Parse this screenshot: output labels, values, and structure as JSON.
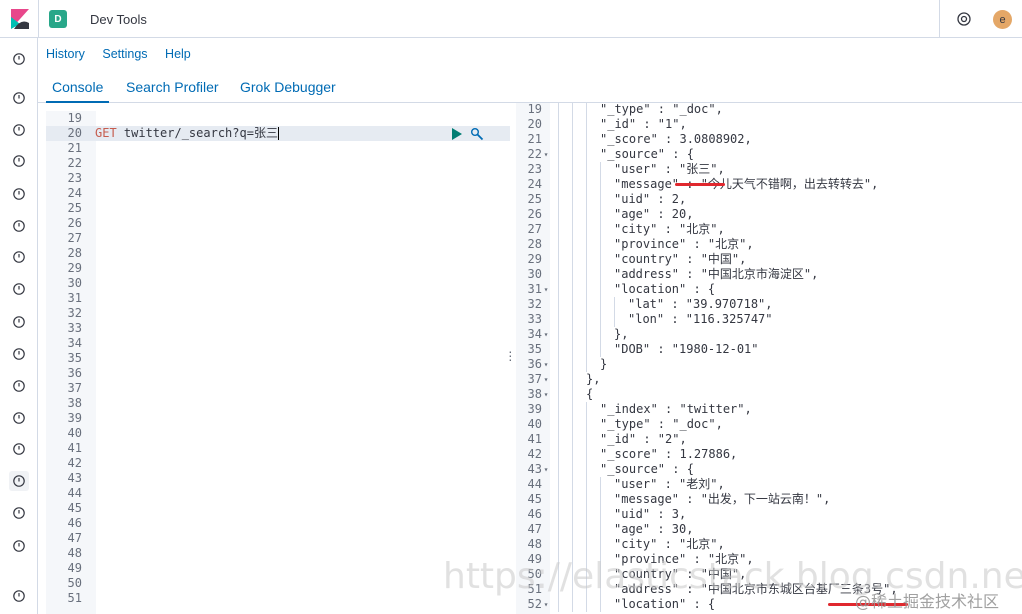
{
  "header": {
    "space_initial": "D",
    "app_title": "Dev Tools",
    "user_initial": "e"
  },
  "subnav": [
    "History",
    "Settings",
    "Help"
  ],
  "tabs": [
    "Console",
    "Search Profiler",
    "Grok Debugger"
  ],
  "sidenav_icons": [
    "clock-icon",
    "compass-icon",
    "visualize-icon",
    "dashboard-icon",
    "canvas-icon",
    "maps-icon",
    "ml-icon",
    "infra-icon",
    "logs-icon",
    "apm-icon",
    "uptime-icon",
    "siem-icon",
    "graph-icon",
    "devtools-icon",
    "monitoring-icon",
    "management-icon",
    "collapse-icon"
  ],
  "request_editor": {
    "first_line": 19,
    "last_line": 51,
    "current_line": 20,
    "method": "GET",
    "path": " twitter/_search?q=张三"
  },
  "response_lines": [
    {
      "n": "19",
      "fold": false,
      "depth": 3,
      "text": "\"_type\" : \"_doc\","
    },
    {
      "n": "20",
      "fold": false,
      "depth": 3,
      "text": "\"_id\" : \"1\","
    },
    {
      "n": "21",
      "fold": false,
      "depth": 3,
      "text": "\"_score\" : 3.0808902,"
    },
    {
      "n": "22",
      "fold": true,
      "depth": 3,
      "text": "\"_source\" : {"
    },
    {
      "n": "23",
      "fold": false,
      "depth": 4,
      "text": "\"user\" : \"张三\","
    },
    {
      "n": "24",
      "fold": false,
      "depth": 4,
      "text": "\"message\" : \"今儿天气不错啊，出去转转去\","
    },
    {
      "n": "25",
      "fold": false,
      "depth": 4,
      "text": "\"uid\" : 2,"
    },
    {
      "n": "26",
      "fold": false,
      "depth": 4,
      "text": "\"age\" : 20,"
    },
    {
      "n": "27",
      "fold": false,
      "depth": 4,
      "text": "\"city\" : \"北京\","
    },
    {
      "n": "28",
      "fold": false,
      "depth": 4,
      "text": "\"province\" : \"北京\","
    },
    {
      "n": "29",
      "fold": false,
      "depth": 4,
      "text": "\"country\" : \"中国\","
    },
    {
      "n": "30",
      "fold": false,
      "depth": 4,
      "text": "\"address\" : \"中国北京市海淀区\","
    },
    {
      "n": "31",
      "fold": true,
      "depth": 4,
      "text": "\"location\" : {"
    },
    {
      "n": "32",
      "fold": false,
      "depth": 5,
      "text": "\"lat\" : \"39.970718\","
    },
    {
      "n": "33",
      "fold": false,
      "depth": 5,
      "text": "\"lon\" : \"116.325747\""
    },
    {
      "n": "34",
      "fold": true,
      "depth": 4,
      "text": "},"
    },
    {
      "n": "35",
      "fold": false,
      "depth": 4,
      "text": "\"DOB\" : \"1980-12-01\""
    },
    {
      "n": "36",
      "fold": true,
      "depth": 3,
      "text": "}"
    },
    {
      "n": "37",
      "fold": true,
      "depth": 2,
      "text": "},"
    },
    {
      "n": "38",
      "fold": true,
      "depth": 2,
      "text": "{"
    },
    {
      "n": "39",
      "fold": false,
      "depth": 3,
      "text": "\"_index\" : \"twitter\","
    },
    {
      "n": "40",
      "fold": false,
      "depth": 3,
      "text": "\"_type\" : \"_doc\","
    },
    {
      "n": "41",
      "fold": false,
      "depth": 3,
      "text": "\"_id\" : \"2\","
    },
    {
      "n": "42",
      "fold": false,
      "depth": 3,
      "text": "\"_score\" : 1.27886,"
    },
    {
      "n": "43",
      "fold": true,
      "depth": 3,
      "text": "\"_source\" : {"
    },
    {
      "n": "44",
      "fold": false,
      "depth": 4,
      "text": "\"user\" : \"老刘\","
    },
    {
      "n": "45",
      "fold": false,
      "depth": 4,
      "text": "\"message\" : \"出发，下一站云南！\","
    },
    {
      "n": "46",
      "fold": false,
      "depth": 4,
      "text": "\"uid\" : 3,"
    },
    {
      "n": "47",
      "fold": false,
      "depth": 4,
      "text": "\"age\" : 30,"
    },
    {
      "n": "48",
      "fold": false,
      "depth": 4,
      "text": "\"city\" : \"北京\","
    },
    {
      "n": "49",
      "fold": false,
      "depth": 4,
      "text": "\"province\" : \"北京\","
    },
    {
      "n": "50",
      "fold": false,
      "depth": 4,
      "text": "\"country\" : \"中国\","
    },
    {
      "n": "51",
      "fold": false,
      "depth": 4,
      "text": "\"address\" : \"中国北京市东城区台基厂三条3号\","
    },
    {
      "n": "52",
      "fold": true,
      "depth": 4,
      "text": "\"location\" : {"
    }
  ],
  "watermark": "https://elasticstack.blog.csdn.net",
  "watermark2": "@稀土掘金技术社区"
}
